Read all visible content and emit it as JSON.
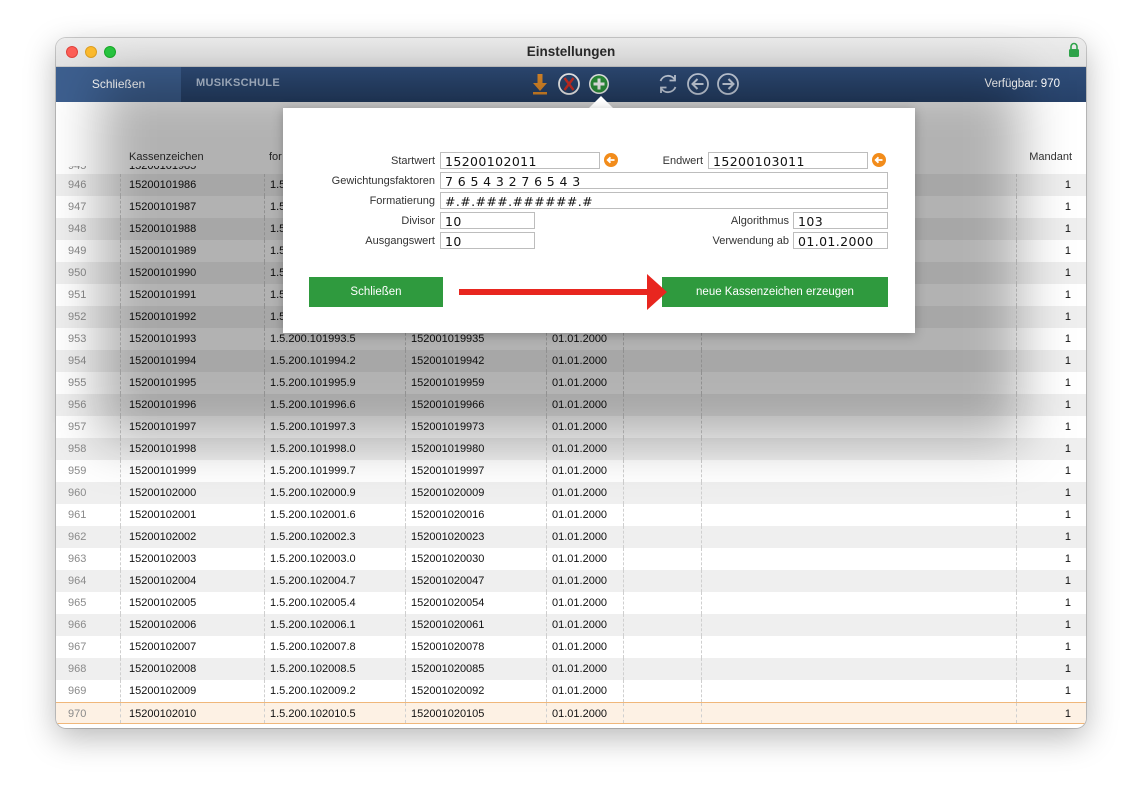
{
  "window": {
    "title": "Einstellungen"
  },
  "toolbar": {
    "close_label": "Schließen",
    "section_label": "MUSIKSCHULE",
    "available": "Verfügbar: 970"
  },
  "table": {
    "headers": {
      "kassenzeichen": "Kassenzeichen",
      "formatted": "for",
      "mandant": "Mandant"
    },
    "rows": [
      {
        "nr": "946",
        "kz": "15200101986",
        "fmt": "1.5",
        "dig": "",
        "date": "",
        "man": "1"
      },
      {
        "nr": "947",
        "kz": "15200101987",
        "fmt": "1.5",
        "dig": "",
        "date": "",
        "man": "1"
      },
      {
        "nr": "948",
        "kz": "15200101988",
        "fmt": "1.5",
        "dig": "",
        "date": "",
        "man": "1"
      },
      {
        "nr": "949",
        "kz": "15200101989",
        "fmt": "1.5",
        "dig": "",
        "date": "",
        "man": "1"
      },
      {
        "nr": "950",
        "kz": "15200101990",
        "fmt": "1.5",
        "dig": "",
        "date": "",
        "man": "1"
      },
      {
        "nr": "951",
        "kz": "15200101991",
        "fmt": "1.5",
        "dig": "",
        "date": "",
        "man": "1"
      },
      {
        "nr": "952",
        "kz": "15200101992",
        "fmt": "1.5",
        "dig": "",
        "date": "",
        "man": "1"
      },
      {
        "nr": "953",
        "kz": "15200101993",
        "fmt": "1.5.200.101993.5",
        "dig": "152001019935",
        "date": "01.01.2000",
        "man": "1"
      },
      {
        "nr": "954",
        "kz": "15200101994",
        "fmt": "1.5.200.101994.2",
        "dig": "152001019942",
        "date": "01.01.2000",
        "man": "1"
      },
      {
        "nr": "955",
        "kz": "15200101995",
        "fmt": "1.5.200.101995.9",
        "dig": "152001019959",
        "date": "01.01.2000",
        "man": "1"
      },
      {
        "nr": "956",
        "kz": "15200101996",
        "fmt": "1.5.200.101996.6",
        "dig": "152001019966",
        "date": "01.01.2000",
        "man": "1"
      },
      {
        "nr": "957",
        "kz": "15200101997",
        "fmt": "1.5.200.101997.3",
        "dig": "152001019973",
        "date": "01.01.2000",
        "man": "1"
      },
      {
        "nr": "958",
        "kz": "15200101998",
        "fmt": "1.5.200.101998.0",
        "dig": "152001019980",
        "date": "01.01.2000",
        "man": "1"
      },
      {
        "nr": "959",
        "kz": "15200101999",
        "fmt": "1.5.200.101999.7",
        "dig": "152001019997",
        "date": "01.01.2000",
        "man": "1"
      },
      {
        "nr": "960",
        "kz": "15200102000",
        "fmt": "1.5.200.102000.9",
        "dig": "152001020009",
        "date": "01.01.2000",
        "man": "1"
      },
      {
        "nr": "961",
        "kz": "15200102001",
        "fmt": "1.5.200.102001.6",
        "dig": "152001020016",
        "date": "01.01.2000",
        "man": "1"
      },
      {
        "nr": "962",
        "kz": "15200102002",
        "fmt": "1.5.200.102002.3",
        "dig": "152001020023",
        "date": "01.01.2000",
        "man": "1"
      },
      {
        "nr": "963",
        "kz": "15200102003",
        "fmt": "1.5.200.102003.0",
        "dig": "152001020030",
        "date": "01.01.2000",
        "man": "1"
      },
      {
        "nr": "964",
        "kz": "15200102004",
        "fmt": "1.5.200.102004.7",
        "dig": "152001020047",
        "date": "01.01.2000",
        "man": "1"
      },
      {
        "nr": "965",
        "kz": "15200102005",
        "fmt": "1.5.200.102005.4",
        "dig": "152001020054",
        "date": "01.01.2000",
        "man": "1"
      },
      {
        "nr": "966",
        "kz": "15200102006",
        "fmt": "1.5.200.102006.1",
        "dig": "152001020061",
        "date": "01.01.2000",
        "man": "1"
      },
      {
        "nr": "967",
        "kz": "15200102007",
        "fmt": "1.5.200.102007.8",
        "dig": "152001020078",
        "date": "01.01.2000",
        "man": "1"
      },
      {
        "nr": "968",
        "kz": "15200102008",
        "fmt": "1.5.200.102008.5",
        "dig": "152001020085",
        "date": "01.01.2000",
        "man": "1"
      },
      {
        "nr": "969",
        "kz": "15200102009",
        "fmt": "1.5.200.102009.2",
        "dig": "152001020092",
        "date": "01.01.2000",
        "man": "1"
      },
      {
        "nr": "970",
        "kz": "15200102010",
        "fmt": "1.5.200.102010.5",
        "dig": "152001020105",
        "date": "01.01.2000",
        "man": "1"
      }
    ],
    "selected_row_nr": "970"
  },
  "dialog": {
    "startwert_label": "Startwert",
    "startwert": "15200102011",
    "endwert_label": "Endwert",
    "endwert": "15200103011",
    "gewichtung_label": "Gewichtungsfaktoren",
    "gewichtung": "7 6 5 4 3 2 7 6 5 4 3",
    "formatierung_label": "Formatierung",
    "formatierung": "#.#.###.######.#",
    "divisor_label": "Divisor",
    "divisor": "10",
    "algorithmus_label": "Algorithmus",
    "algorithmus": "103",
    "ausgangswert_label": "Ausgangswert",
    "ausgangswert": "10",
    "verwendung_label": "Verwendung ab",
    "verwendung": "01.01.2000",
    "close_button": "Schließen",
    "generate_button": "neue Kassenzeichen erzeugen"
  },
  "colors": {
    "toolbar": "#2c4873",
    "accent_green": "#2f9a3e",
    "accent_orange": "#f28c1b",
    "arrow_red": "#e8261f"
  },
  "icons": [
    "download-icon",
    "delete-icon",
    "add-icon",
    "refresh-icon",
    "arrow-left-icon",
    "arrow-right-icon",
    "lock-icon"
  ]
}
